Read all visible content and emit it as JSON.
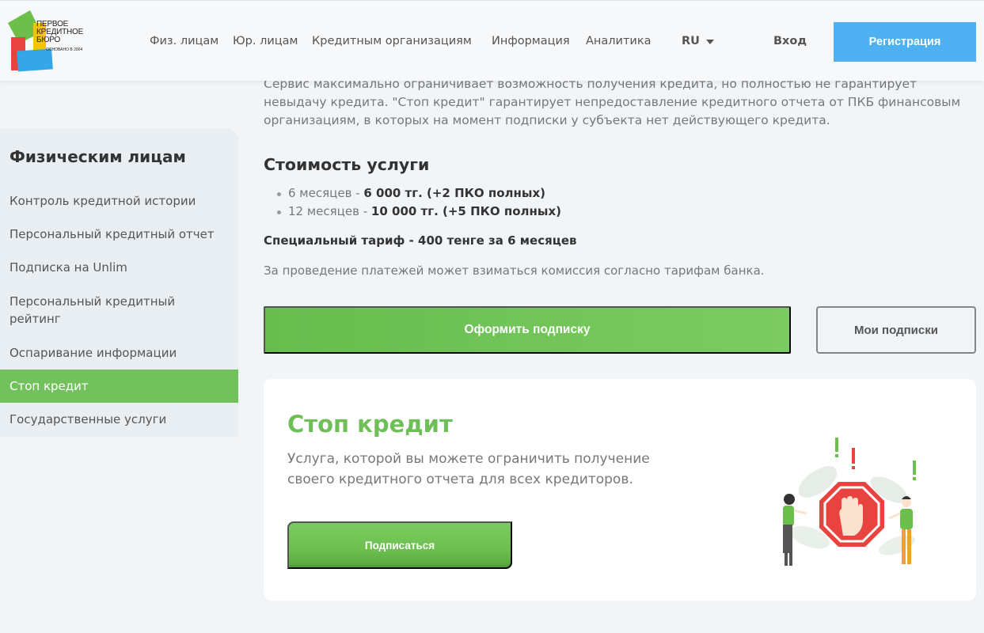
{
  "header": {
    "logo_lines": [
      "ПЕРВОЕ",
      "КРЕДИТНОЕ",
      "БЮРО"
    ],
    "logo_small": "ОСНОВАНО В 2004",
    "nav": [
      "Физ. лицам",
      "Юр. лицам",
      "Кредитным организациям",
      "Информация",
      "Аналитика"
    ],
    "language": "RU",
    "login": "Вход",
    "register": "Регистрация"
  },
  "sidebar": {
    "title": "Физическим лицам",
    "items": [
      "Контроль кредитной истории",
      "Персональный кредитный отчет",
      "Подписка на Unlim",
      "Персональный кредитный рейтинг",
      "Оспаривание информации",
      "Стоп кредит",
      "Государственные услуги"
    ],
    "active_item": "Стоп кредит"
  },
  "main": {
    "intro": "Сервис максимально ограничивает возможность получения кредита, но полностью не гарантирует невыдачу кредита. \"Стоп кредит\" гарантирует непредоставление кредитного отчета от ПКБ финансовым организациям, в которых на момент подписки у субъекта нет действующего кредита.",
    "price_title": "Стоимость услуги",
    "prices": [
      {
        "period": "6 месяцев - ",
        "value": "6 000 тг. (+2 ПКО полных)"
      },
      {
        "period": "12 месяцев - ",
        "value": "10 000 тг. (+5 ПКО полных)"
      }
    ],
    "special": "Специальный тариф - 400 тенге за 6 месяцев",
    "commission": "За проведение платежей может взиматься комиссия согласно тарифам банка.",
    "subscribe_button": "Оформить подписку",
    "my_subscriptions_button": "Мои подписки"
  },
  "card": {
    "title": "Стоп кредит",
    "description": "Услуга, которой вы можете ограничить получение своего кредитного отчета для всех кредиторов.",
    "button": "Подписаться"
  },
  "colors": {
    "accent_green": "#72c15c",
    "accent_blue": "#4fb0f2",
    "stop_red": "#e8433e"
  }
}
